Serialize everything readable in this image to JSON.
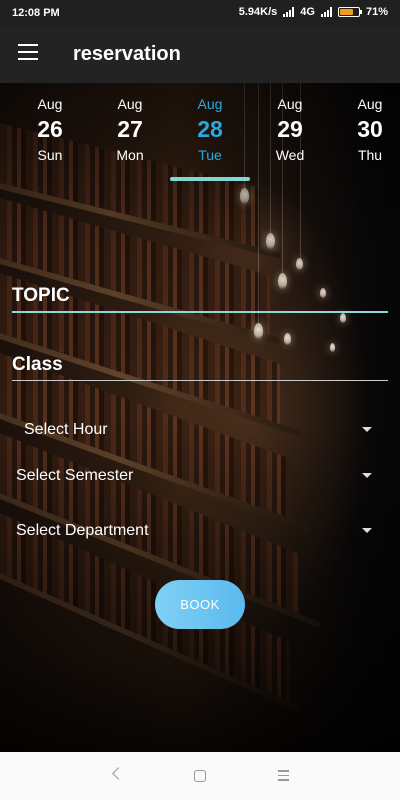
{
  "status_bar": {
    "time": "12:08 PM",
    "speed": "5.94K/s",
    "network": "4G",
    "battery": "71%",
    "battery_level": 0.71,
    "battery_color": "#f29b20"
  },
  "app_bar": {
    "title": "reservation",
    "menu_icon": "hamburger-menu-icon"
  },
  "dates": [
    {
      "month": "Aug",
      "day": "26",
      "weekday": "Sun",
      "selected": false
    },
    {
      "month": "Aug",
      "day": "27",
      "weekday": "Mon",
      "selected": false
    },
    {
      "month": "Aug",
      "day": "28",
      "weekday": "Tue",
      "selected": true
    },
    {
      "month": "Aug",
      "day": "29",
      "weekday": "Wed",
      "selected": false
    },
    {
      "month": "Aug",
      "day": "30",
      "weekday": "Thu",
      "selected": false
    }
  ],
  "form": {
    "topic_label": "TOPIC",
    "class_label": "Class",
    "hour_select": "Select Hour",
    "semester_select": "Select Semester",
    "department_select": "Select Department",
    "book_button": "BOOK"
  },
  "colors": {
    "accent": "#29a9e0",
    "tab_indicator": "#7fd9d2",
    "topic_underline": "#8fd6da",
    "class_underline": "#cccccc",
    "button_gradient_start": "#7fd1f5",
    "button_gradient_end": "#5bb9ee"
  },
  "nav_bar": {
    "back_icon": "back-chevron-icon",
    "home_icon": "home-square-icon",
    "recents_icon": "recents-lines-icon"
  }
}
